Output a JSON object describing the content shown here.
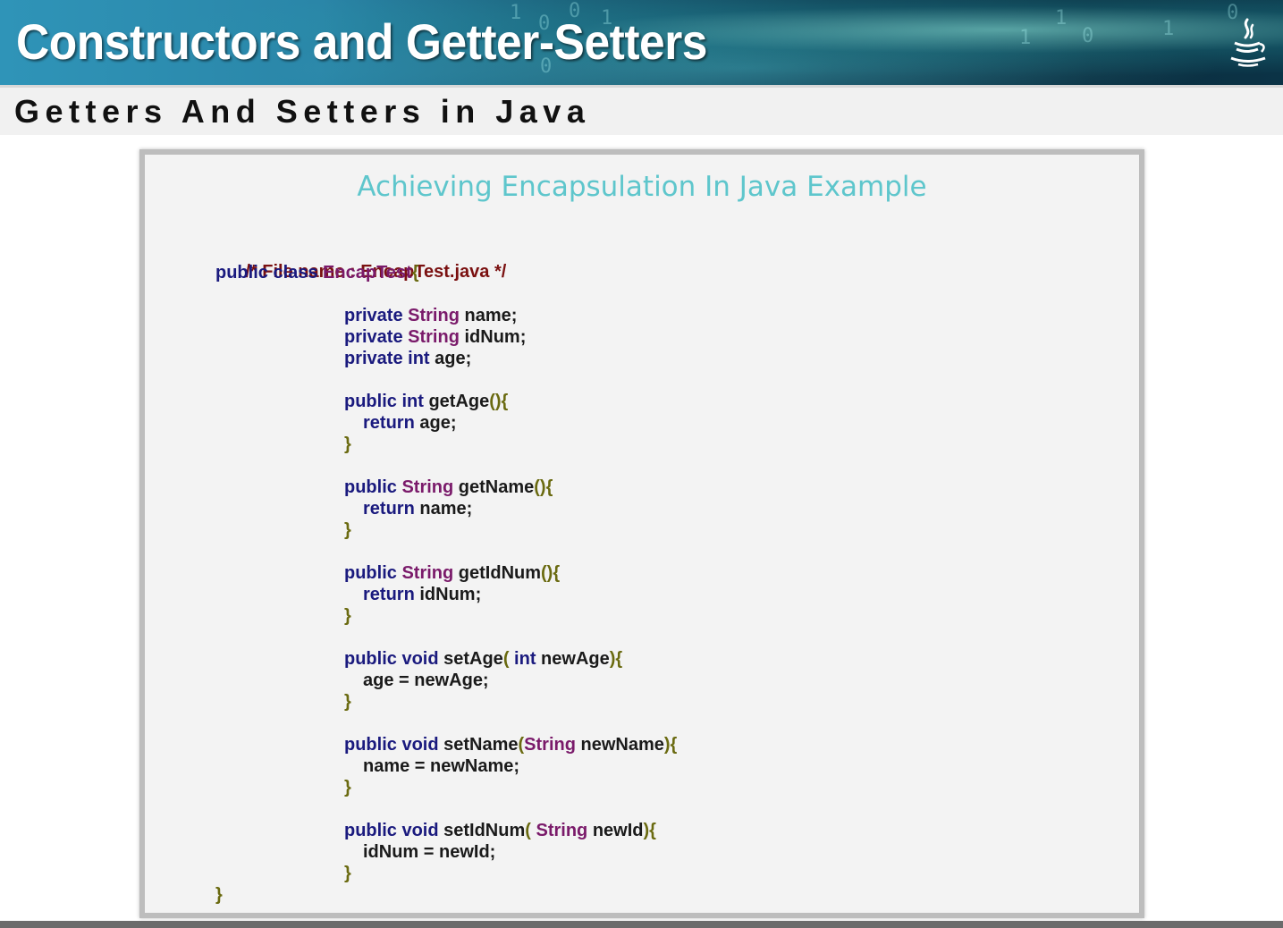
{
  "header": {
    "title": "Constructors and Getter-Setters",
    "binary_digits": [
      "1",
      "0",
      "0",
      "1",
      "0",
      "1",
      "1",
      "0",
      "1",
      "0"
    ]
  },
  "subheader": {
    "title": "Getters And Setters in Java"
  },
  "slide": {
    "title": "Achieving Encapsulation In Java Example",
    "code": {
      "l1": {
        "comment": "/* File name : EncapTest.java */"
      },
      "l2": {
        "kw": "public class",
        "name": " EncapTest",
        "brace": "{"
      },
      "l3": {
        "kw": "private",
        "type": " String",
        "rest": " name;"
      },
      "l4": {
        "kw": "private",
        "type": " String",
        "rest": " idNum;"
      },
      "l5": {
        "kw": "private int",
        "rest": " age;"
      },
      "l6": {
        "kw": "public int",
        "rest": " getAge",
        "brace": "(){"
      },
      "l7": {
        "kw": "return",
        "rest": " age;"
      },
      "l8": {
        "brace": "}"
      },
      "l9": {
        "kw": "public",
        "type": " String",
        "rest": " getName",
        "brace": "(){"
      },
      "l10": {
        "kw": "return",
        "rest": " name;"
      },
      "l11": {
        "brace": "}"
      },
      "l12": {
        "kw": "public",
        "type": " String",
        "rest": " getIdNum",
        "brace": "(){"
      },
      "l13": {
        "kw": "return",
        "rest": " idNum;"
      },
      "l14": {
        "brace": "}"
      },
      "l15": {
        "kw": "public void",
        "rest": " setAge",
        "b1": "(",
        "kw2": " int",
        "rest2": " newAge",
        "brace": "){"
      },
      "l16": {
        "rest": "age = newAge;"
      },
      "l17": {
        "brace": "}"
      },
      "l18": {
        "kw": "public void",
        "rest": " setName",
        "b1": "(",
        "type": "String",
        "rest2": " newName",
        "brace": "){"
      },
      "l19": {
        "rest": "name = newName;"
      },
      "l20": {
        "brace": "}"
      },
      "l21": {
        "kw": "public void",
        "rest": " setIdNum",
        "b1": "(",
        "type": " String",
        "rest2": " newId",
        "brace": "){"
      },
      "l22": {
        "rest": "idNum = newId;"
      },
      "l23": {
        "brace": "}"
      },
      "l24": {
        "brace": "}"
      }
    }
  }
}
